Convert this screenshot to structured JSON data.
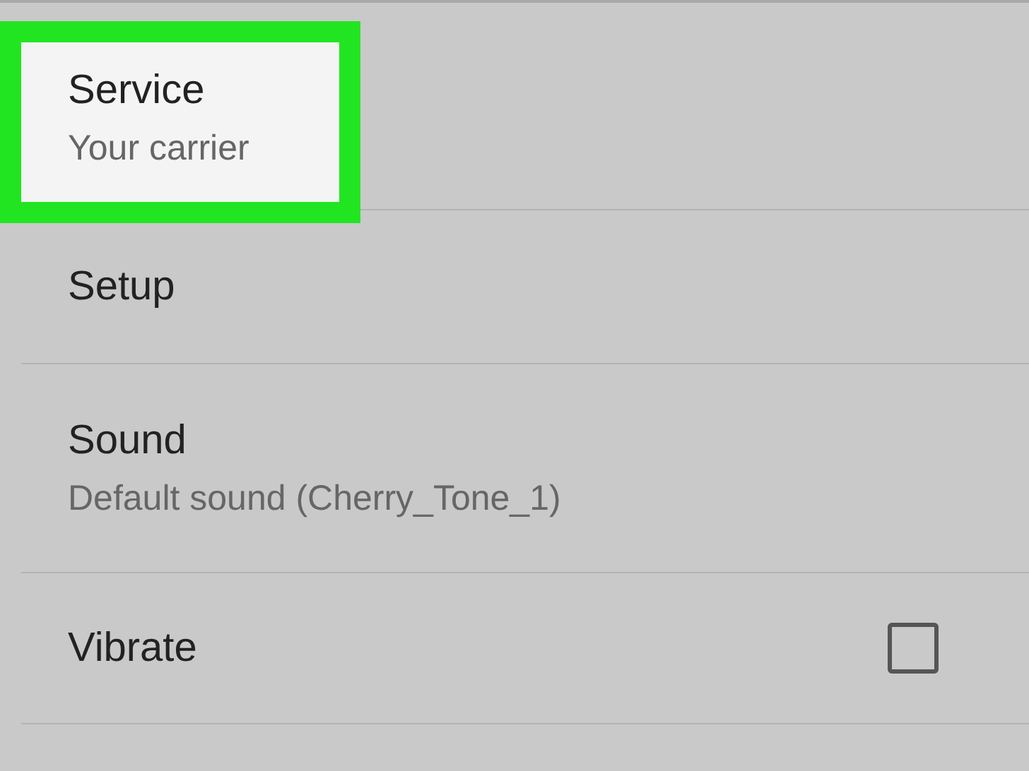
{
  "settings": [
    {
      "kind": "text",
      "title": "Service",
      "subtitle": "Your carrier",
      "selected": true
    },
    {
      "kind": "text",
      "title": "Setup",
      "selected": false
    },
    {
      "kind": "text",
      "title": "Sound",
      "subtitle": "Default sound (Cherry_Tone_1)",
      "selected": false
    },
    {
      "kind": "checkbox",
      "title": "Vibrate",
      "checked": false,
      "selected": false
    }
  ]
}
